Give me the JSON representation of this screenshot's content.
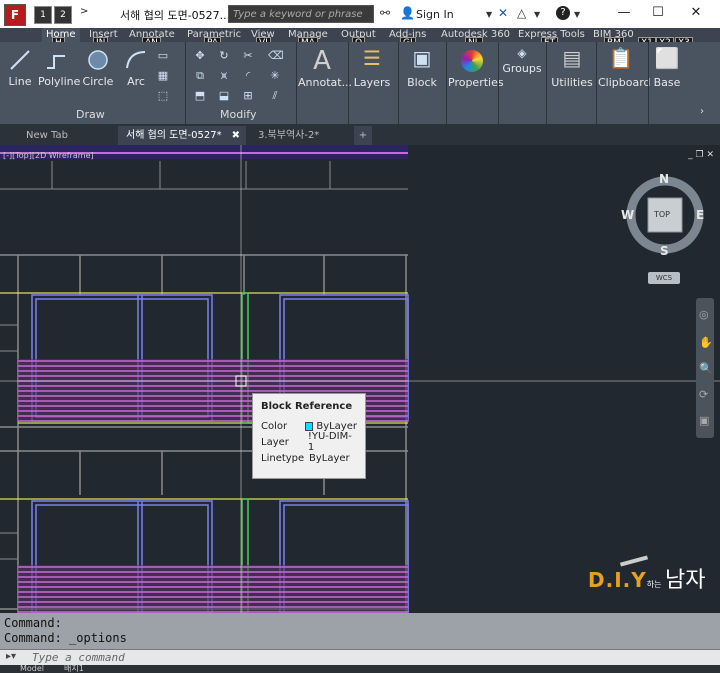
{
  "titlebar": {
    "qat": [
      "1",
      "2"
    ],
    "doc_title": "서해 협의 도면-0527...",
    "search_placeholder": "Type a keyword or phrase",
    "sign_in": "Sign In"
  },
  "ribbon_tabs": [
    {
      "label": "Home",
      "keytip": "H",
      "active": true
    },
    {
      "label": "Insert",
      "keytip": "IN"
    },
    {
      "label": "Annotate",
      "keytip": "AN"
    },
    {
      "label": "Parametric",
      "keytip": "PA"
    },
    {
      "label": "View",
      "keytip": "VI"
    },
    {
      "label": "Manage",
      "keytip": "MA"
    },
    {
      "label": "Output",
      "keytip": "O"
    },
    {
      "label": "Add-ins",
      "keytip": "GI"
    },
    {
      "label": "Autodesk 360",
      "keytip": "NL"
    },
    {
      "label": "Express Tools",
      "keytip": "ET"
    },
    {
      "label": "BIM 360",
      "keytip": "BM"
    }
  ],
  "extra_keytips": [
    "X1",
    "X2",
    "X3"
  ],
  "ribbon": {
    "draw_buttons": [
      "Line",
      "Polyline",
      "Circle",
      "Arc"
    ],
    "draw_panel": "Draw",
    "modify_panel": "Modify",
    "right_buttons": [
      "Annotat...",
      "Layers",
      "Block",
      "Properties",
      "Groups",
      "Utilities",
      "Clipboard",
      "Base"
    ]
  },
  "doc_tabs": [
    {
      "label": "New Tab"
    },
    {
      "label": "서해 협의 도면-0527*",
      "active": true
    },
    {
      "label": "3.북부역사-2*"
    }
  ],
  "viewport_label": "[-][Top][2D Wireframe]",
  "viewcube": {
    "n": "N",
    "s": "S",
    "e": "E",
    "w": "W",
    "face": "TOP",
    "wcs": "WCS"
  },
  "tooltip": {
    "title": "Block Reference",
    "rows": [
      {
        "key": "Color",
        "value": "ByLayer"
      },
      {
        "key": "Layer",
        "value": "!YU-DIM-1"
      },
      {
        "key": "Linetype",
        "value": "ByLayer"
      }
    ]
  },
  "watermark": {
    "brand": "D.I.Y",
    "small": "하는",
    "name": "남자"
  },
  "command": {
    "history": [
      "Command:",
      "Command: _options"
    ],
    "placeholder": "Type a command"
  },
  "statusbar": {
    "tabs": [
      "Model",
      "배치1"
    ]
  },
  "colors": {
    "magenta": "#c76bd6",
    "blue": "#7b7ff2",
    "yellow": "#e0e050",
    "green": "#55c955",
    "grey": "#8a8a8a",
    "cyan": "#00e5ff"
  }
}
